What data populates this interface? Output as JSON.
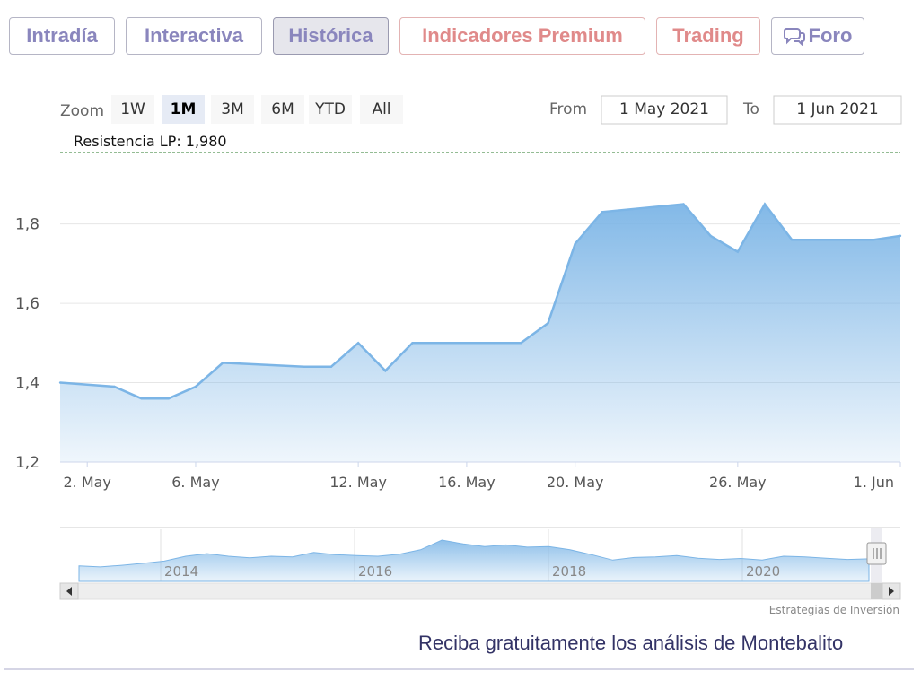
{
  "tabs": [
    {
      "label": "Intradía",
      "active": false,
      "premium": false
    },
    {
      "label": "Interactiva",
      "active": false,
      "premium": false
    },
    {
      "label": "Histórica",
      "active": true,
      "premium": false
    },
    {
      "label": "Indicadores Premium",
      "active": false,
      "premium": true
    },
    {
      "label": "Trading",
      "active": false,
      "premium": true
    },
    {
      "label": "Foro",
      "active": false,
      "premium": false,
      "icon": "chat-bubble-icon"
    }
  ],
  "zoom": {
    "label": "Zoom",
    "buttons": [
      "1W",
      "1M",
      "3M",
      "6M",
      "YTD",
      "All"
    ],
    "selected": "1M"
  },
  "range": {
    "from_label": "From",
    "from_value": "1 May 2021",
    "to_label": "To",
    "to_value": "1 Jun 2021"
  },
  "footer": {
    "credits": "Estrategias de Inversión",
    "cta": "Reciba gratuitamente los análisis de Montebalito"
  },
  "colors": {
    "tab_text": "#8a86bd",
    "premium_text": "#e08a8a",
    "series_line": "#7cb5e6",
    "resistance_line": "#2a7a2a"
  },
  "chart_data": {
    "type": "area",
    "x_labels": [
      "2. May",
      "6. May",
      "12. May",
      "16. May",
      "20. May",
      "26. May",
      "1. Jun"
    ],
    "x": [
      "2021-05-01",
      "2021-05-03",
      "2021-05-04",
      "2021-05-05",
      "2021-05-06",
      "2021-05-07",
      "2021-05-10",
      "2021-05-11",
      "2021-05-12",
      "2021-05-13",
      "2021-05-14",
      "2021-05-17",
      "2021-05-18",
      "2021-05-19",
      "2021-05-20",
      "2021-05-21",
      "2021-05-24",
      "2021-05-25",
      "2021-05-26",
      "2021-05-27",
      "2021-05-28",
      "2021-05-31",
      "2021-06-01"
    ],
    "values": [
      1.4,
      1.39,
      1.36,
      1.36,
      1.39,
      1.45,
      1.44,
      1.44,
      1.5,
      1.43,
      1.5,
      1.5,
      1.5,
      1.55,
      1.75,
      1.83,
      1.85,
      1.77,
      1.73,
      1.85,
      1.76,
      1.76,
      1.77
    ],
    "yticks": [
      "1,2",
      "1,4",
      "1,6",
      "1,8"
    ],
    "ylim": [
      1.2,
      1.98
    ],
    "resistance": {
      "label": "Resistencia LP: 1,980",
      "value": 1.98
    },
    "grid": true,
    "navigator": {
      "labels": [
        "2014",
        "2016",
        "2018",
        "2020"
      ],
      "values": [
        0.2,
        0.17,
        0.22,
        0.28,
        0.35,
        0.5,
        0.58,
        0.5,
        0.45,
        0.5,
        0.48,
        0.62,
        0.55,
        0.52,
        0.5,
        0.56,
        0.7,
        1.0,
        0.88,
        0.8,
        0.85,
        0.78,
        0.8,
        0.7,
        0.55,
        0.38,
        0.46,
        0.48,
        0.52,
        0.44,
        0.4,
        0.43,
        0.38,
        0.5,
        0.48,
        0.44,
        0.4,
        0.42
      ]
    }
  }
}
